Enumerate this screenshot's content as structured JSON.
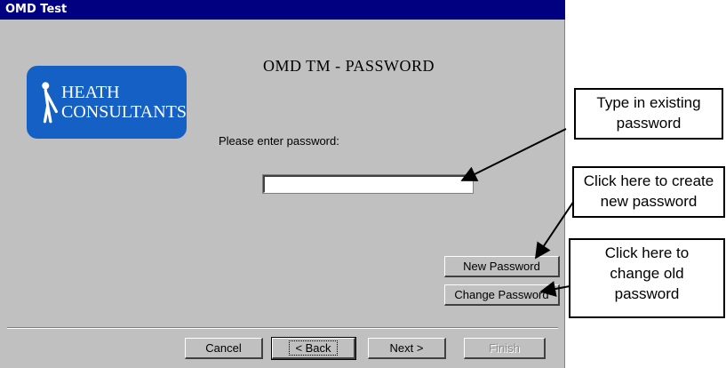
{
  "window": {
    "title": "OMD Test"
  },
  "logo": {
    "text": "HEATH\nCONSULTANTS"
  },
  "heading": "OMD TM - PASSWORD",
  "prompt": "Please enter password:",
  "password_field": {
    "value": ""
  },
  "buttons": {
    "new_password": "New Password",
    "change_password": "Change Password",
    "cancel": "Cancel",
    "back": "< Back",
    "next": "Next >",
    "finish": "Finish"
  },
  "callouts": {
    "existing": "Type in existing\npassword",
    "create": "Click here to create\nnew password",
    "change": "Click here to\nchange old\npassword"
  },
  "colors": {
    "titlebar": "#000080",
    "window_bg": "#c0c0c0",
    "logo_bg": "#1560c4"
  }
}
